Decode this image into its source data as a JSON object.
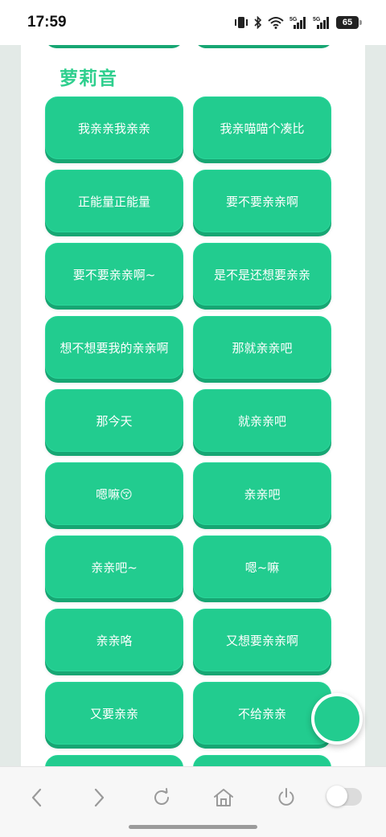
{
  "status": {
    "time": "17:59",
    "battery": "65",
    "signal1": "5G",
    "signal2": "5G"
  },
  "section": {
    "title": "萝莉音"
  },
  "buttons": [
    "我亲亲我亲亲",
    "我亲喵喵个凑比",
    "正能量正能量",
    "要不要亲亲啊",
    "要不要亲亲啊~",
    "是不是还想要亲亲",
    "想不想要我的亲亲啊",
    "那就亲亲吧",
    "那今天",
    "就亲亲吧",
    "嗯嘛😚",
    "亲亲吧",
    "亲亲吧~",
    "嗯~嘛",
    "亲亲咯",
    "又想要亲亲啊",
    "又要亲亲",
    "不给亲亲",
    "",
    ""
  ],
  "colors": {
    "accent": "#22cc8f",
    "accent_shadow": "#17a673",
    "title": "#2fcf8e"
  },
  "nav": {
    "icons": [
      "back-icon",
      "forward-icon",
      "refresh-icon",
      "home-icon",
      "power-icon",
      "toggle-switch"
    ]
  }
}
